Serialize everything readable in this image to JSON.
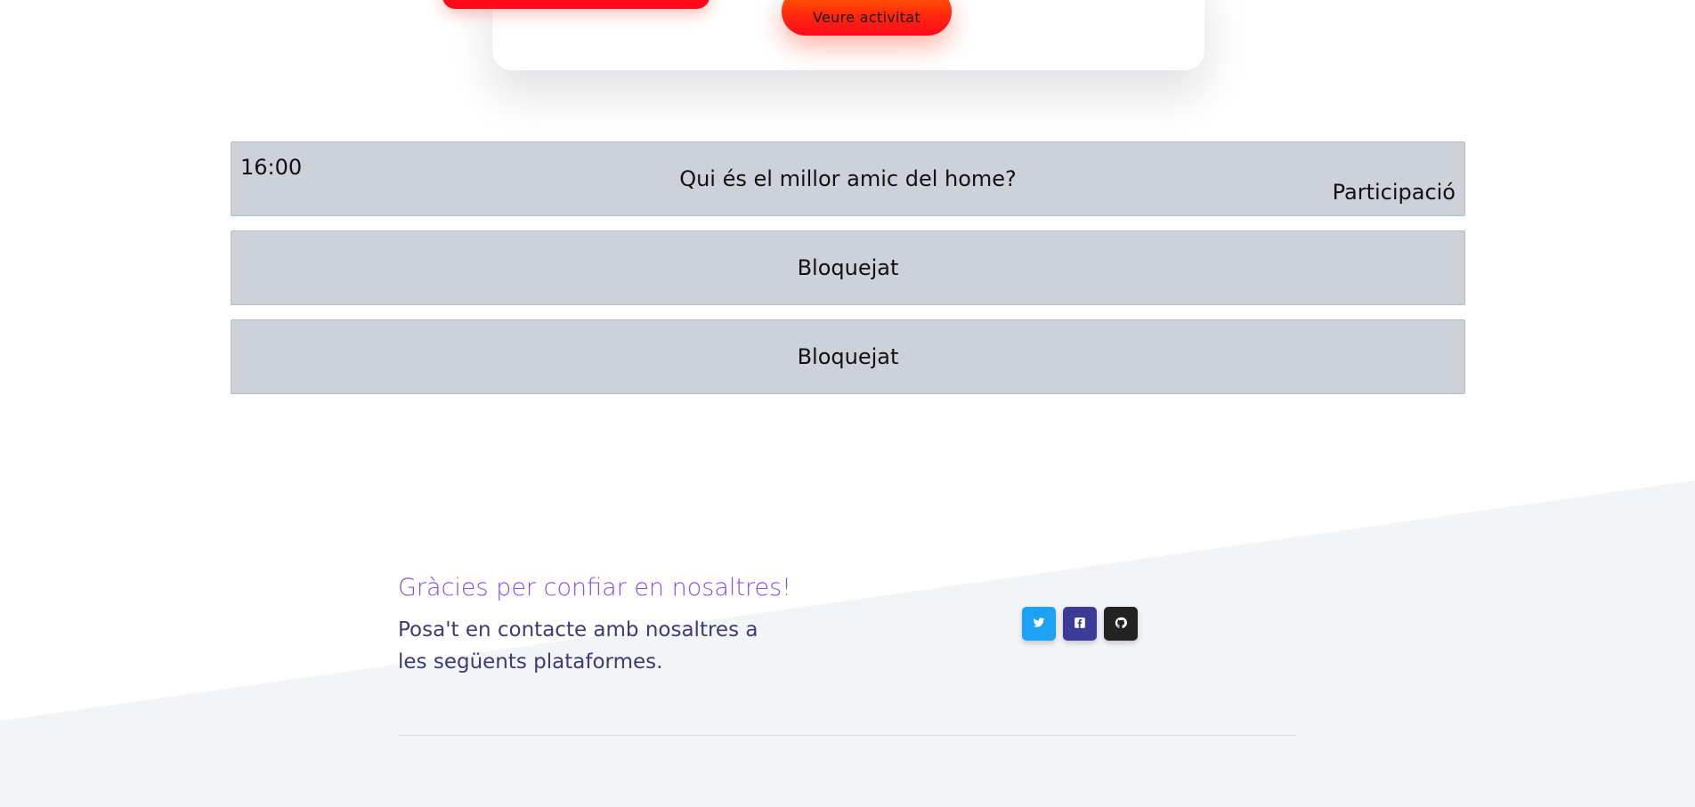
{
  "top_card": {
    "button_label": "Veure activitat",
    "accent_color": "#ff0a1a"
  },
  "activities": [
    {
      "time": "16:00",
      "question": "Qui és el millor amic del home?",
      "tag": "Participació"
    },
    {
      "label": "Bloquejat"
    },
    {
      "label": "Bloquejat"
    }
  ],
  "footer": {
    "title": "Gràcies per confiar en nosaltres!",
    "text": "Posa't en contacte amb nosaltres a les següents plataformes.",
    "social": [
      {
        "icon": "twitter-icon",
        "color": "#1da1f2"
      },
      {
        "icon": "facebook-icon",
        "color": "#3b3b98"
      },
      {
        "icon": "github-icon",
        "color": "#222222"
      }
    ]
  },
  "colors": {
    "row_background": "#cdd1da",
    "footer_background": "#f3f4f6",
    "title_color": "#8a4ce0",
    "text_color": "#3f3a72"
  }
}
